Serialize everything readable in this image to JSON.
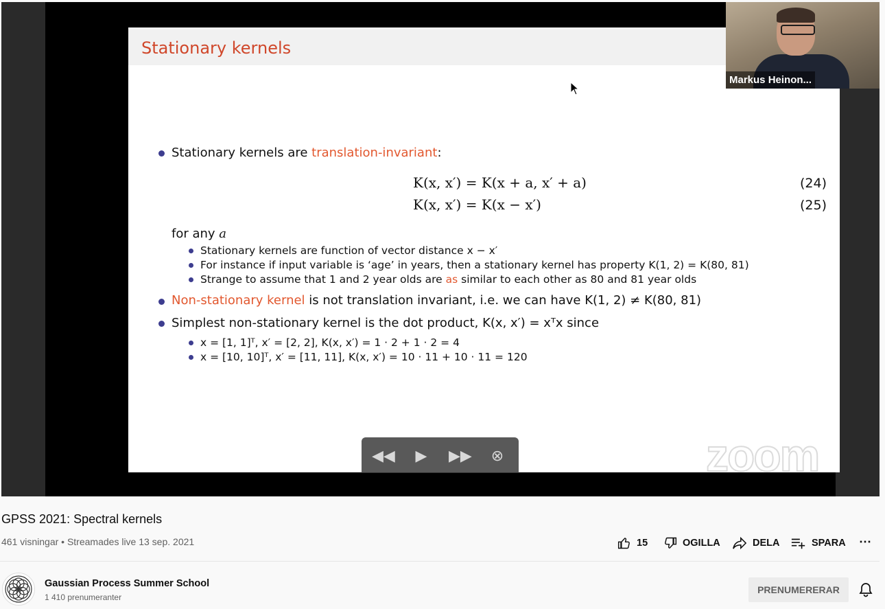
{
  "slide": {
    "title": "Stationary kernels",
    "bullet1_prefix": "Stationary kernels are ",
    "bullet1_highlight": "translation-invariant",
    "bullet1_suffix": ":",
    "eq24": "K(x, x′) = K(x + a, x′ + a)",
    "eq24_no": "(24)",
    "eq25": "K(x, x′) = K(x − x′)",
    "eq25_no": "(25)",
    "for_any": "for any ",
    "for_any_var": "a",
    "sub1": "Stationary kernels are function of vector distance x − x′",
    "sub2": "For instance if input variable is ‘age’ in years, then a stationary kernel has property K(1, 2) = K(80, 81)",
    "sub3_prefix": "Strange to assume that 1 and 2 year olds are ",
    "sub3_highlight": "as",
    "sub3_suffix": " similar to each other as 80 and 81 year olds",
    "bullet2_highlight": "Non-stationary kernel",
    "bullet2_suffix": " is not translation invariant, i.e. we can have K(1, 2) ≠ K(80, 81)",
    "bullet3": "Simplest non-stationary kernel is the dot product, K(x, x′) = xᵀx since",
    "sub4": "x = [1, 1]ᵀ, x′ = [2, 2], K(x, x′) = 1 · 2 + 1 · 2 = 4",
    "sub5": "x = [10, 10]ᵀ, x′ = [11, 11], K(x, x′) = 10 · 11 + 10 · 11 = 120"
  },
  "webcam": {
    "name": "Markus Heinon..."
  },
  "zoom_logo": "zoom",
  "controls": {
    "rewind": "◀◀",
    "play": "▶",
    "forward": "▶▶",
    "close": "⊗"
  },
  "video": {
    "title": "GPSS 2021: Spectral kernels",
    "meta": "461 visningar • Streamades live 13 sep. 2021",
    "likes": "15",
    "dislike_label": "OGILLA",
    "share_label": "DELA",
    "save_label": "SPARA",
    "more": "⋯"
  },
  "channel": {
    "name": "Gaussian Process Summer School",
    "subscribers": "1 410 prenumeranter",
    "subscribe_label": "PRENUMERERAR"
  },
  "icons": [
    "thumbs-up-icon",
    "thumbs-down-icon",
    "share-icon",
    "playlist-add-icon",
    "more-icon",
    "bell-icon",
    "mouse-cursor-icon"
  ]
}
